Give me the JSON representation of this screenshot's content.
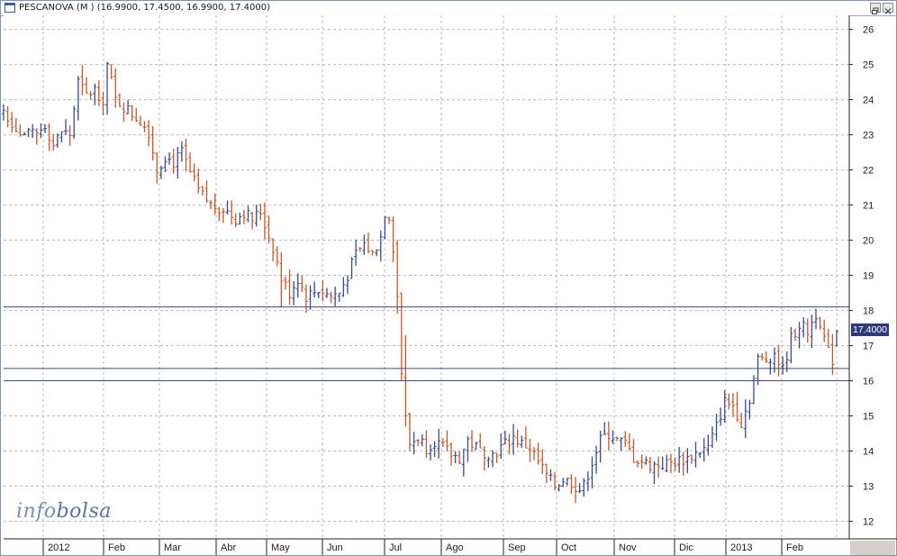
{
  "window": {
    "title": "PESCANOVA (M ) (16.9900, 17.4500, 16.9900, 17.4000)",
    "icon": "chart-window-icon",
    "buttons": [
      "restore-icon",
      "close-icon"
    ]
  },
  "watermark": {
    "part1": "info",
    "part2": "bolsa"
  },
  "last_price_label": "17.4000",
  "colors": {
    "up": "#3a4a8c",
    "down": "#c0582a",
    "grid": "#b9b9b9",
    "hline": "#3b4a82",
    "axis": "#222222",
    "last_price_bg": "#2f3a7a",
    "watermark": "#7d8bb6"
  },
  "chart_data": {
    "type": "ohlc-bar",
    "title": "PESCANOVA (M ) (16.9900, 17.4500, 16.9900, 17.4000)",
    "last": {
      "open": 16.99,
      "high": 17.45,
      "low": 16.99,
      "close": 17.4
    },
    "y_axis": {
      "side": "right",
      "min": 11.5,
      "max": 26.4,
      "ticks": [
        12,
        13,
        14,
        15,
        16,
        17,
        18,
        19,
        20,
        21,
        22,
        23,
        24,
        25,
        26
      ]
    },
    "x_axis": {
      "labels": [
        "2012",
        "Feb",
        "Mar",
        "Abr",
        "May",
        "Jun",
        "Jul",
        "Ago",
        "Sep",
        "Oct",
        "Nov",
        "Dic",
        "2013",
        "Feb"
      ]
    },
    "grid": true,
    "horizontal_lines": [
      18.1,
      16.35,
      16.0
    ],
    "close_path": [
      [
        0,
        23.7
      ],
      [
        4,
        23.0
      ],
      [
        8,
        23.0
      ],
      [
        10,
        23.3
      ],
      [
        12,
        22.7
      ],
      [
        14,
        23.1
      ],
      [
        16,
        23.0
      ],
      [
        18,
        24.5
      ],
      [
        20,
        24.1
      ],
      [
        22,
        24.3
      ],
      [
        24,
        24.0
      ],
      [
        25,
        25.0
      ],
      [
        27,
        24.0
      ],
      [
        30,
        23.7
      ],
      [
        33,
        23.4
      ],
      [
        35,
        23.1
      ],
      [
        37,
        22.0
      ],
      [
        39,
        22.4
      ],
      [
        41,
        22.2
      ],
      [
        43,
        22.5
      ],
      [
        45,
        21.9
      ],
      [
        47,
        21.4
      ],
      [
        50,
        21.0
      ],
      [
        53,
        20.9
      ],
      [
        56,
        20.6
      ],
      [
        58,
        20.8
      ],
      [
        60,
        20.6
      ],
      [
        62,
        20.8
      ],
      [
        64,
        20.1
      ],
      [
        65,
        19.8
      ],
      [
        67,
        18.9
      ],
      [
        69,
        18.5
      ],
      [
        71,
        18.9
      ],
      [
        73,
        18.4
      ],
      [
        76,
        18.6
      ],
      [
        79,
        18.4
      ],
      [
        81,
        18.5
      ],
      [
        83,
        19.0
      ],
      [
        85,
        19.6
      ],
      [
        87,
        19.9
      ],
      [
        89,
        19.6
      ],
      [
        91,
        20.1
      ],
      [
        92,
        20.8
      ],
      [
        93,
        20.7
      ],
      [
        94,
        19.8
      ],
      [
        95,
        17.2
      ],
      [
        96,
        16.1
      ],
      [
        97,
        15.6
      ],
      [
        98,
        14.2
      ],
      [
        100,
        14.4
      ],
      [
        102,
        14.1
      ],
      [
        104,
        14.3
      ],
      [
        106,
        14.1
      ],
      [
        108,
        13.9
      ],
      [
        110,
        13.8
      ],
      [
        112,
        14.3
      ],
      [
        115,
        14.0
      ],
      [
        118,
        13.9
      ],
      [
        121,
        14.2
      ],
      [
        123,
        14.4
      ],
      [
        125,
        14.2
      ],
      [
        127,
        14.1
      ],
      [
        129,
        13.7
      ],
      [
        131,
        13.3
      ],
      [
        133,
        13.0
      ],
      [
        135,
        13.2
      ],
      [
        137,
        13.1
      ],
      [
        139,
        12.9
      ],
      [
        140,
        13.0
      ],
      [
        142,
        13.7
      ],
      [
        144,
        14.3
      ],
      [
        146,
        14.5
      ],
      [
        148,
        14.3
      ],
      [
        150,
        14.2
      ],
      [
        152,
        13.8
      ],
      [
        154,
        13.7
      ],
      [
        156,
        13.6
      ],
      [
        159,
        13.6
      ],
      [
        162,
        13.7
      ],
      [
        165,
        13.8
      ],
      [
        168,
        14.0
      ],
      [
        170,
        14.1
      ],
      [
        172,
        14.7
      ],
      [
        174,
        15.4
      ],
      [
        176,
        15.3
      ],
      [
        178,
        14.8
      ],
      [
        180,
        15.5
      ],
      [
        182,
        16.6
      ],
      [
        184,
        16.6
      ],
      [
        186,
        16.8
      ],
      [
        188,
        16.3
      ],
      [
        190,
        17.2
      ],
      [
        192,
        17.6
      ],
      [
        194,
        17.4
      ],
      [
        196,
        17.9
      ],
      [
        197,
        17.7
      ],
      [
        198,
        17.2
      ],
      [
        199,
        16.8
      ],
      [
        200,
        16.6
      ],
      [
        201,
        17.4
      ]
    ]
  }
}
